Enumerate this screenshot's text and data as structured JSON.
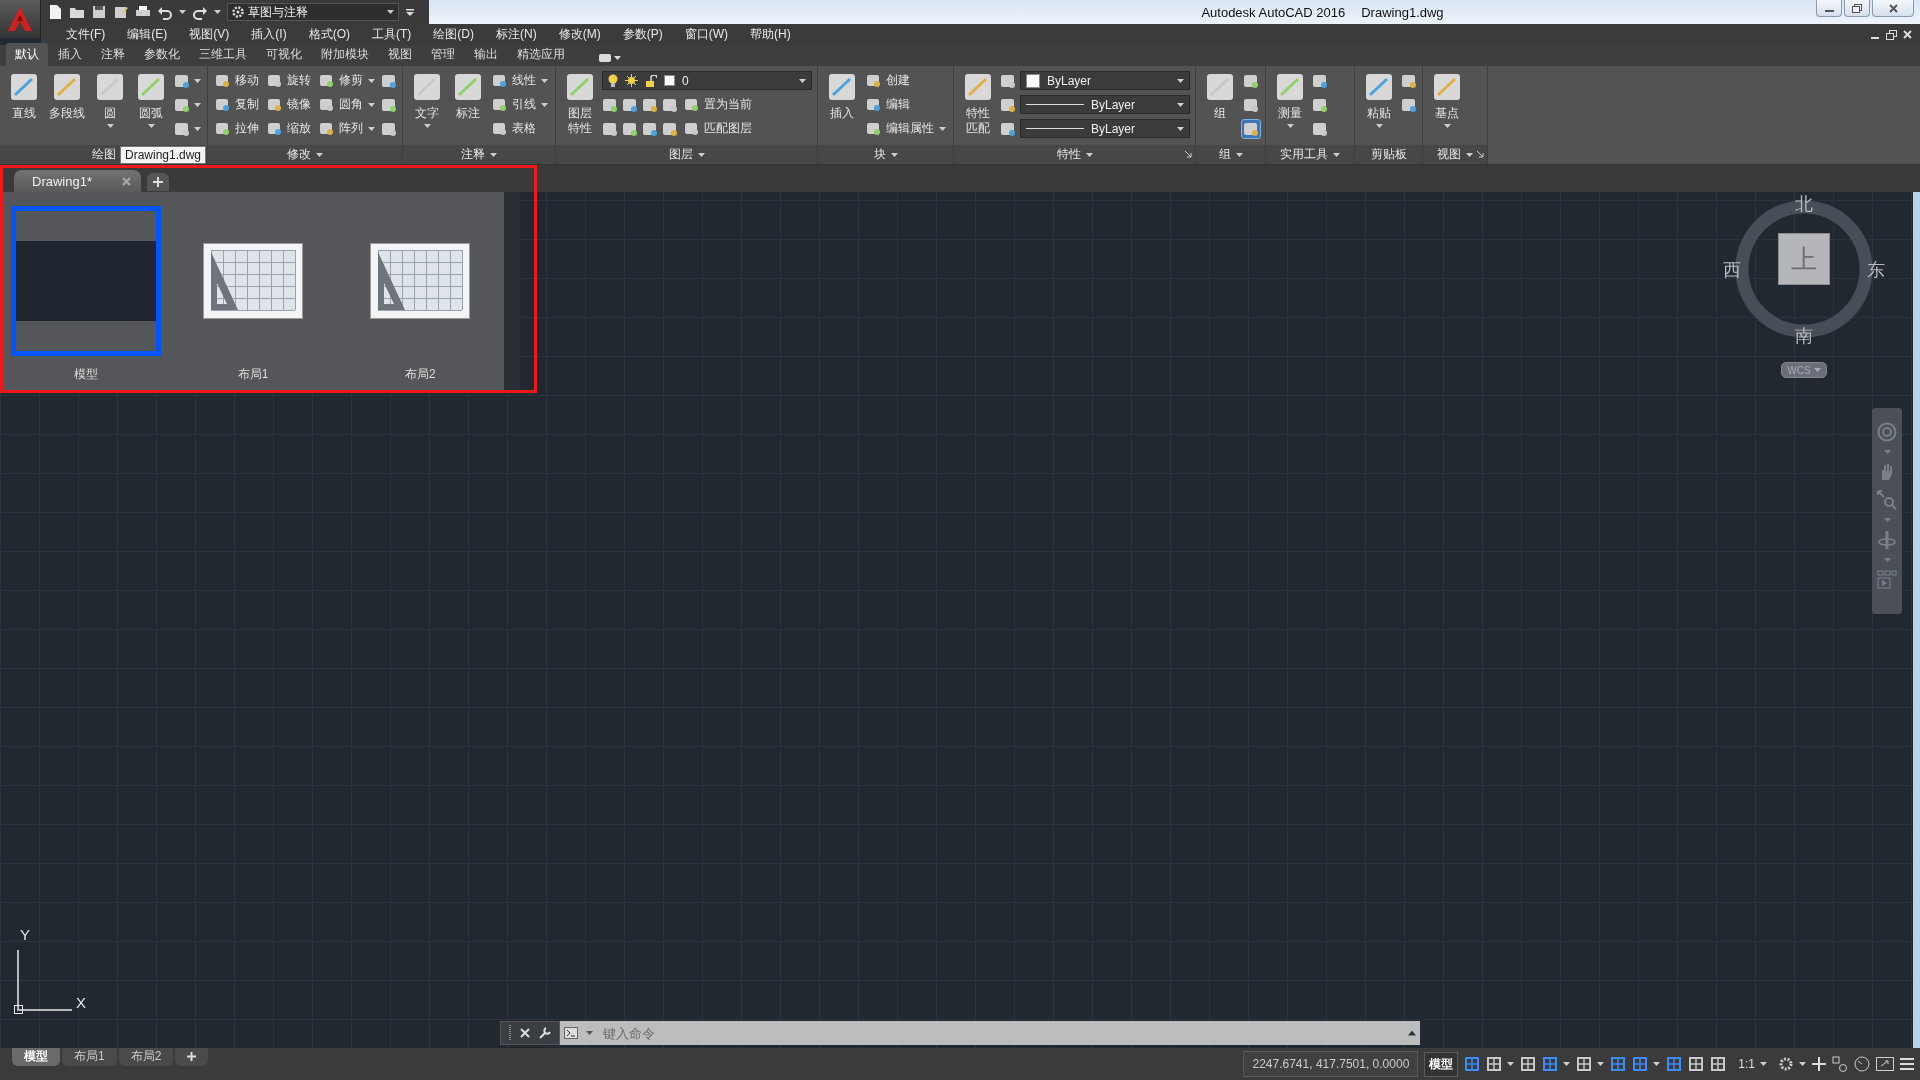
{
  "quick_access": {
    "workspace": "草图与注释"
  },
  "title": {
    "app": "Autodesk AutoCAD 2016",
    "file": "Drawing1.dwg"
  },
  "menus": [
    "文件(F)",
    "编辑(E)",
    "视图(V)",
    "插入(I)",
    "格式(O)",
    "工具(T)",
    "绘图(D)",
    "标注(N)",
    "修改(M)",
    "参数(P)",
    "窗口(W)",
    "帮助(H)"
  ],
  "ribbon_tabs": [
    {
      "label": "默认",
      "selected": true
    },
    {
      "label": "插入",
      "selected": false
    },
    {
      "label": "注释",
      "selected": false
    },
    {
      "label": "参数化",
      "selected": false
    },
    {
      "label": "三维工具",
      "selected": false
    },
    {
      "label": "可视化",
      "selected": false
    },
    {
      "label": "附加模块",
      "selected": false
    },
    {
      "label": "视图",
      "selected": false
    },
    {
      "label": "管理",
      "selected": false
    },
    {
      "label": "输出",
      "selected": false
    },
    {
      "label": "精选应用",
      "selected": false
    }
  ],
  "ribbon_panels": [
    {
      "title": "绘图",
      "menu": false,
      "launcher": false,
      "items": [
        {
          "kind": "large",
          "label": "直线",
          "menu": false
        },
        {
          "kind": "large",
          "label": "多段线",
          "menu": false
        },
        {
          "kind": "large",
          "label": "圆",
          "menu": true
        },
        {
          "kind": "large",
          "label": "圆弧",
          "menu": true
        },
        {
          "kind": "stack",
          "rows": [
            [
              {
                "kind": "icon",
                "menu": true
              }
            ],
            [
              {
                "kind": "icon",
                "menu": true
              }
            ],
            [
              {
                "kind": "icon",
                "menu": true
              }
            ]
          ]
        }
      ]
    },
    {
      "title": "修改",
      "menu": true,
      "launcher": false,
      "items": [
        {
          "kind": "stack",
          "rows": [
            [
              {
                "kind": "small",
                "label": "移动",
                "menu": false
              },
              {
                "kind": "small",
                "label": "旋转",
                "menu": false
              },
              {
                "kind": "small",
                "label": "修剪",
                "menu": true
              },
              {
                "kind": "icon",
                "menu": false
              }
            ],
            [
              {
                "kind": "small",
                "label": "复制",
                "menu": false
              },
              {
                "kind": "small",
                "label": "镜像",
                "menu": false
              },
              {
                "kind": "small",
                "label": "圆角",
                "menu": true
              },
              {
                "kind": "icon",
                "menu": false
              }
            ],
            [
              {
                "kind": "small",
                "label": "拉伸",
                "menu": false
              },
              {
                "kind": "small",
                "label": "缩放",
                "menu": false
              },
              {
                "kind": "small",
                "label": "阵列",
                "menu": true
              },
              {
                "kind": "icon",
                "menu": false
              }
            ]
          ]
        }
      ]
    },
    {
      "title": "注释",
      "menu": true,
      "launcher": false,
      "items": [
        {
          "kind": "large",
          "label": "文字",
          "menu": true
        },
        {
          "kind": "large",
          "label": "标注",
          "menu": false
        },
        {
          "kind": "stack",
          "rows": [
            [
              {
                "kind": "small",
                "label": "线性",
                "menu": true
              }
            ],
            [
              {
                "kind": "small",
                "label": "引线",
                "menu": true
              }
            ],
            [
              {
                "kind": "small",
                "label": "表格",
                "menu": false
              }
            ]
          ]
        }
      ]
    },
    {
      "title": "图层",
      "menu": true,
      "launcher": false,
      "items": [
        {
          "kind": "tall",
          "label": "图层特性",
          "menu": false
        },
        {
          "kind": "stack",
          "rows": [
            [
              {
                "kind": "layercombo",
                "value": "0"
              }
            ],
            [
              {
                "kind": "icon",
                "menu": false
              },
              {
                "kind": "icon",
                "menu": false
              },
              {
                "kind": "icon",
                "menu": false
              },
              {
                "kind": "icon",
                "menu": false
              },
              {
                "kind": "small",
                "label": "置为当前",
                "menu": false
              }
            ],
            [
              {
                "kind": "icon",
                "menu": false
              },
              {
                "kind": "icon",
                "menu": false
              },
              {
                "kind": "icon",
                "menu": false
              },
              {
                "kind": "icon",
                "menu": false
              },
              {
                "kind": "small",
                "label": "匹配图层",
                "menu": false
              }
            ]
          ]
        }
      ]
    },
    {
      "title": "块",
      "menu": true,
      "launcher": false,
      "items": [
        {
          "kind": "large",
          "label": "插入",
          "menu": false
        },
        {
          "kind": "stack",
          "rows": [
            [
              {
                "kind": "small",
                "label": "创建",
                "menu": false
              }
            ],
            [
              {
                "kind": "small",
                "label": "编辑",
                "menu": false
              }
            ],
            [
              {
                "kind": "small",
                "label": "编辑属性",
                "menu": true
              }
            ]
          ]
        }
      ]
    },
    {
      "title": "特性",
      "menu": true,
      "launcher": true,
      "items": [
        {
          "kind": "tall",
          "label": "特性匹配",
          "menu": false
        },
        {
          "kind": "stack",
          "rows": [
            [
              {
                "kind": "icon",
                "menu": false
              },
              {
                "kind": "colorcombo",
                "value": "ByLayer"
              }
            ],
            [
              {
                "kind": "icon",
                "menu": false
              },
              {
                "kind": "linecombo",
                "value": "ByLayer"
              }
            ],
            [
              {
                "kind": "icon",
                "menu": false
              },
              {
                "kind": "linecombo",
                "value": "ByLayer"
              }
            ]
          ]
        }
      ]
    },
    {
      "title": "组",
      "menu": true,
      "launcher": false,
      "items": [
        {
          "kind": "large",
          "label": "组",
          "menu": false
        },
        {
          "kind": "stack",
          "rows": [
            [
              {
                "kind": "icon",
                "menu": false,
                "on": false
              }
            ],
            [
              {
                "kind": "icon",
                "menu": false,
                "on": false
              }
            ],
            [
              {
                "kind": "icon",
                "menu": false,
                "on": true
              }
            ]
          ]
        }
      ]
    },
    {
      "title": "实用工具",
      "menu": true,
      "launcher": false,
      "items": [
        {
          "kind": "large",
          "label": "测量",
          "menu": true
        },
        {
          "kind": "stack",
          "rows": [
            [
              {
                "kind": "icon",
                "menu": false
              }
            ],
            [
              {
                "kind": "icon",
                "menu": false
              }
            ],
            [
              {
                "kind": "icon",
                "menu": false
              }
            ]
          ]
        }
      ]
    },
    {
      "title": "剪贴板",
      "menu": false,
      "launcher": false,
      "items": [
        {
          "kind": "large",
          "label": "粘贴",
          "menu": true
        },
        {
          "kind": "stack",
          "rows": [
            [
              {
                "kind": "icon",
                "menu": false
              }
            ],
            [
              {
                "kind": "icon",
                "menu": false
              }
            ]
          ]
        }
      ]
    },
    {
      "title": "视图",
      "menu": true,
      "launcher": true,
      "items": [
        {
          "kind": "large",
          "label": "基点",
          "menu": true
        }
      ]
    }
  ],
  "doc_tabs": [
    {
      "label": "Drawing1*",
      "selected": true,
      "tooltip": "Drawing1.dwg"
    }
  ],
  "layout_previews": [
    {
      "label": "模型",
      "kind": "model",
      "selected": true
    },
    {
      "label": "布局1",
      "kind": "layout",
      "selected": false
    },
    {
      "label": "布局2",
      "kind": "layout",
      "selected": false
    }
  ],
  "viewcube": {
    "north": "北",
    "south": "南",
    "east": "东",
    "west": "西",
    "face": "上",
    "coordinate_system": "WCS"
  },
  "ucs": {
    "x": "X",
    "y": "Y"
  },
  "command_line": {
    "placeholder": "键入命令"
  },
  "layout_tabs": [
    {
      "label": "模型",
      "selected": true
    },
    {
      "label": "布局1",
      "selected": false
    },
    {
      "label": "布局2",
      "selected": false
    }
  ],
  "status_bar": {
    "coordinates": "2247.6741, 417.7501, 0.0000",
    "space": "模型",
    "annotation_scale": "1:1",
    "toggles": [
      {
        "on": true,
        "menu": false
      },
      {
        "on": false,
        "menu": true
      },
      {
        "on": false,
        "menu": false
      },
      {
        "on": true,
        "menu": true
      },
      {
        "on": false,
        "menu": true
      },
      {
        "on": true,
        "menu": false
      },
      {
        "on": true,
        "menu": true
      },
      {
        "on": true,
        "menu": false
      },
      {
        "on": false,
        "menu": false
      },
      {
        "on": false,
        "menu": false
      }
    ]
  }
}
